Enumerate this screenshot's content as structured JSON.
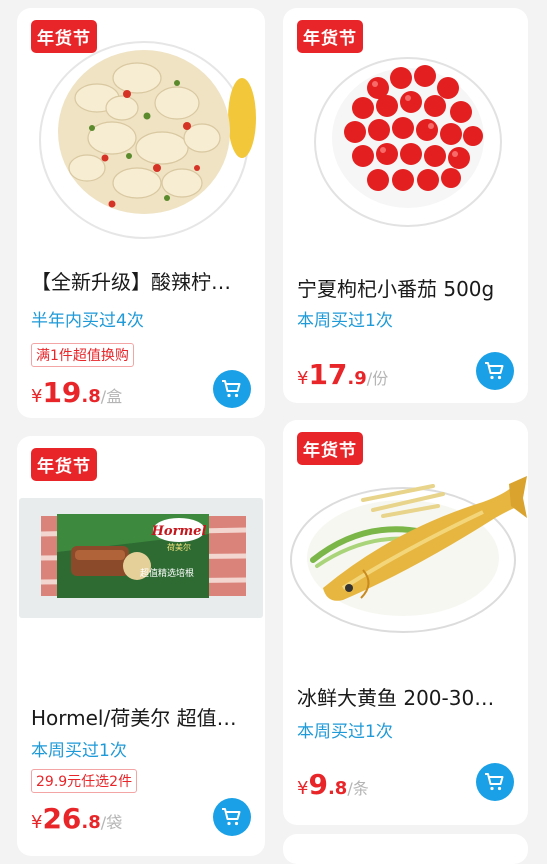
{
  "products": [
    {
      "badge": "年货节",
      "title": "【全新升级】酸辣柠…",
      "bought": "半年内买过4次",
      "promo": "满1件超值换购",
      "price": {
        "symbol": "¥",
        "integer": "19",
        "decimal": ".8",
        "unit": "/盒"
      }
    },
    {
      "badge": "年货节",
      "title": "宁夏枸杞小番茄 500g",
      "bought": "本周买过1次",
      "price": {
        "symbol": "¥",
        "integer": "17",
        "decimal": ".9",
        "unit": "/份"
      }
    },
    {
      "badge": "年货节",
      "title": "Hormel/荷美尔 超值…",
      "bought": "本周买过1次",
      "promo": "29.9元任选2件",
      "price": {
        "symbol": "¥",
        "integer": "26",
        "decimal": ".8",
        "unit": "/袋"
      },
      "package_text": {
        "brand": "Hormel",
        "brand_cn": "荷美尔",
        "label": "超值精选培根"
      }
    },
    {
      "badge": "年货节",
      "title": "冰鲜大黄鱼 200-30…",
      "bought": "本周买过1次",
      "price": {
        "symbol": "¥",
        "integer": "9",
        "decimal": ".8",
        "unit": "/条"
      }
    }
  ],
  "icons": {
    "cart": "shopping-cart-icon"
  },
  "colors": {
    "badge": "#e8262a",
    "price": "#e8262a",
    "bought": "#1f9ad8",
    "cart_button": "#1aa0e6"
  }
}
